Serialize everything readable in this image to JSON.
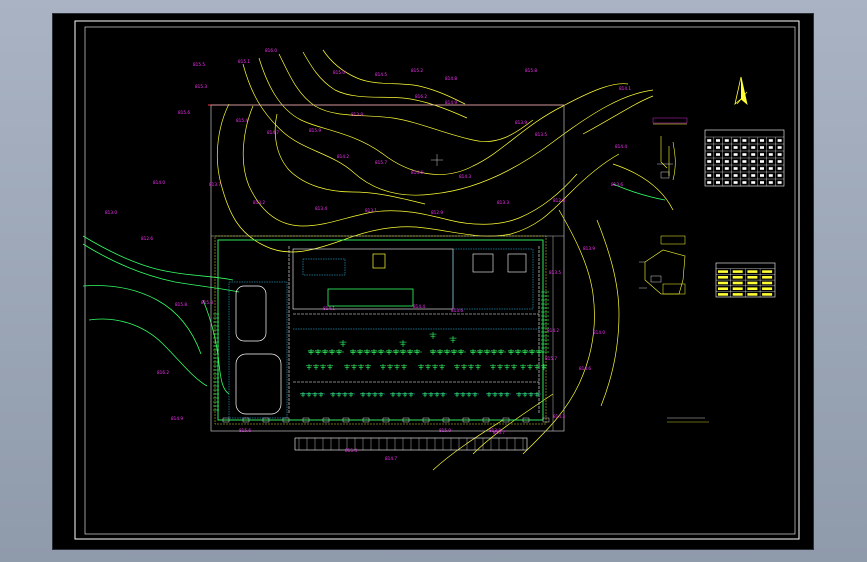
{
  "drawing": {
    "background": "#000000",
    "colors": {
      "frame": "#ffffff",
      "contour": "#ffff33",
      "contour_alt": "#d8d820",
      "label": "#ff33ff",
      "green": "#33ff66",
      "red": "#ff3344",
      "cyan": "#33ccff",
      "white": "#ffffff"
    },
    "contour_labels": [
      "815.5",
      "815.1",
      "816.0",
      "815.0",
      "814.5",
      "815.2",
      "814.8",
      "815.8",
      "815.3",
      "816.2",
      "814.9",
      "815.6",
      "815.4",
      "814.7",
      "815.9",
      "813.8",
      "814.2",
      "815.7",
      "814.6",
      "814.3",
      "813.9",
      "813.5",
      "814.1",
      "814.4",
      "813.6",
      "814.0",
      "813.7",
      "813.2",
      "813.4",
      "813.1",
      "812.9",
      "813.3",
      "812.8",
      "813.0",
      "812.6"
    ],
    "north_arrow": {
      "icon": "north-arrow-icon"
    },
    "tables": [
      "site-data-table",
      "legend-table"
    ]
  }
}
